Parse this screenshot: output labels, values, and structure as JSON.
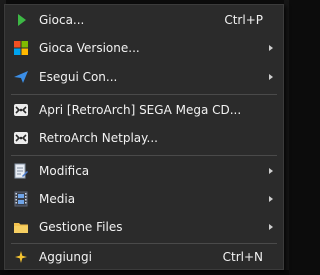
{
  "menu": {
    "items": [
      {
        "label": "Gioca...",
        "shortcut": "Ctrl+P",
        "icon": "play-icon",
        "submenu": false
      },
      {
        "label": "Gioca Versione...",
        "shortcut": "",
        "icon": "windows-logo-icon",
        "submenu": true
      },
      {
        "label": "Esegui Con...",
        "shortcut": "",
        "icon": "paper-plane-icon",
        "submenu": true
      },
      {
        "label": "Apri [RetroArch] SEGA Mega CD...",
        "shortcut": "",
        "icon": "retroarch-icon",
        "submenu": false
      },
      {
        "label": "RetroArch Netplay...",
        "shortcut": "",
        "icon": "retroarch-icon",
        "submenu": false
      },
      {
        "label": "Modifica",
        "shortcut": "",
        "icon": "document-edit-icon",
        "submenu": true
      },
      {
        "label": "Media",
        "shortcut": "",
        "icon": "film-strip-icon",
        "submenu": true
      },
      {
        "label": "Gestione Files",
        "shortcut": "",
        "icon": "folder-icon",
        "submenu": true
      },
      {
        "label": "Aggiungi",
        "shortcut": "Ctrl+N",
        "icon": "add-sparkle-icon",
        "submenu": false
      }
    ]
  },
  "colors": {
    "menu_bg": "#2b2b2b",
    "text": "#f2f2f2",
    "separator": "#4a4a4a",
    "play_green": "#3db845",
    "folder_yellow": "#f2c14e"
  }
}
